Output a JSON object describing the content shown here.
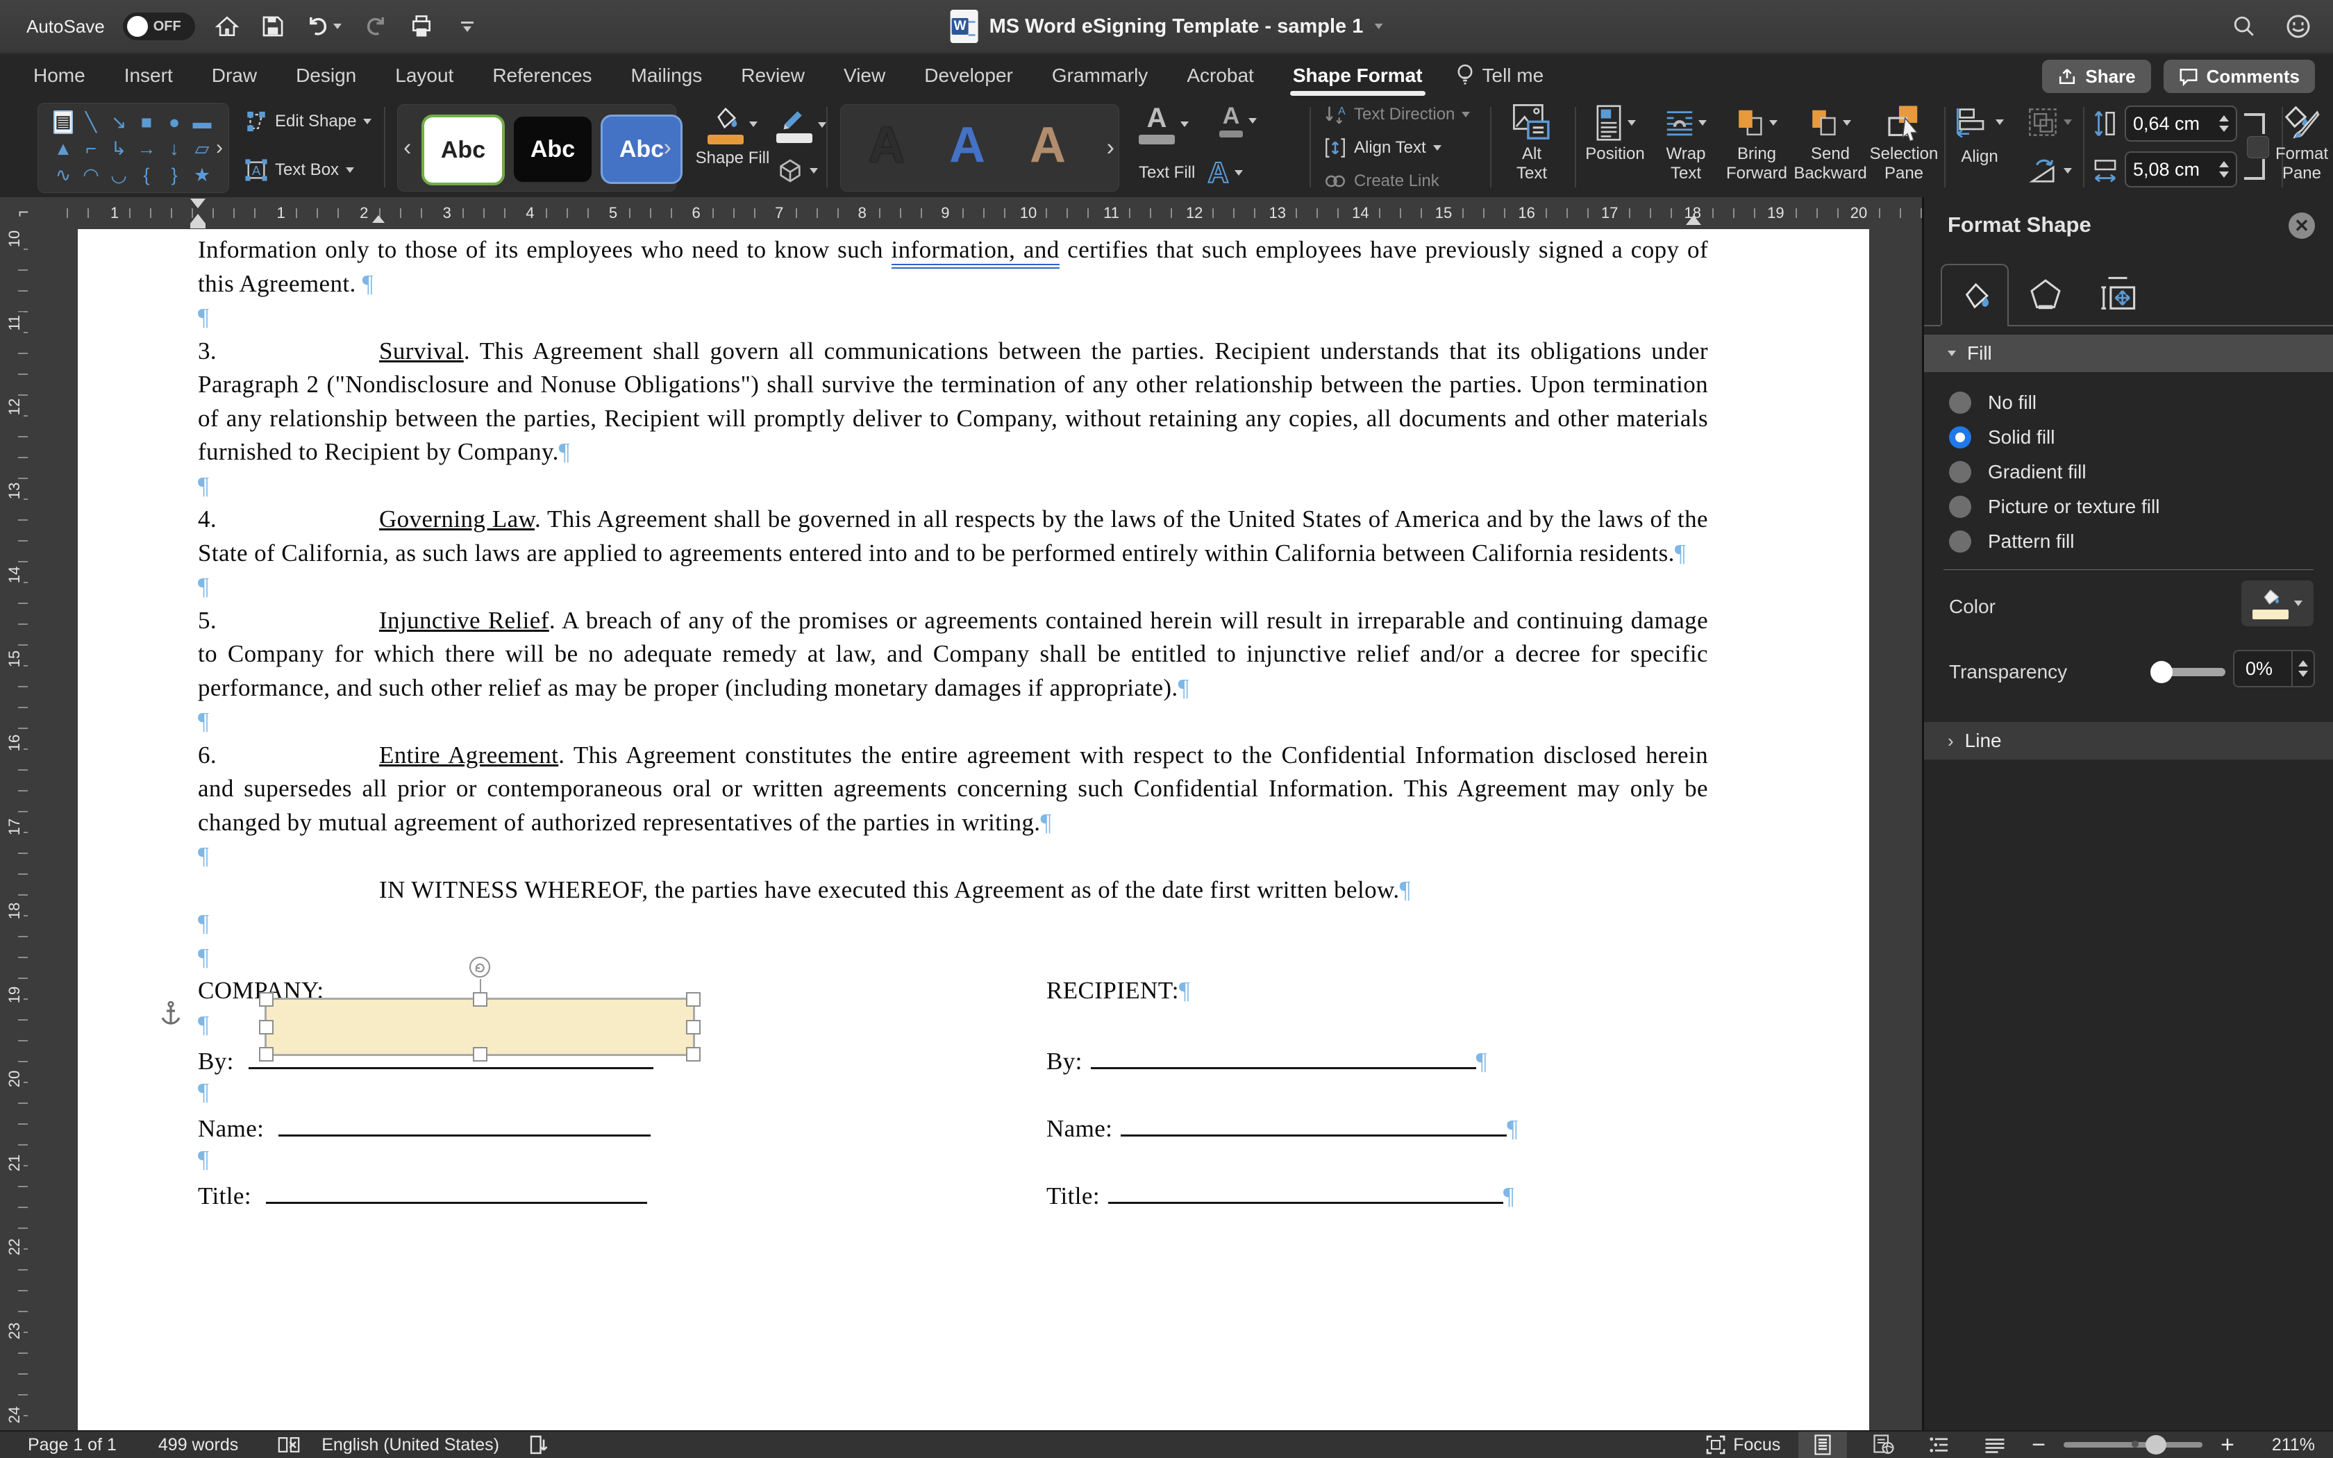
{
  "titlebar": {
    "autosave_label": "AutoSave",
    "autosave_state": "OFF",
    "title": "MS Word eSigning Template - sample 1"
  },
  "tabs": {
    "items": [
      "Home",
      "Insert",
      "Draw",
      "Design",
      "Layout",
      "References",
      "Mailings",
      "Review",
      "View",
      "Developer",
      "Grammarly",
      "Acrobat",
      "Shape Format"
    ],
    "active": "Shape Format",
    "tell_me": "Tell me",
    "share": "Share",
    "comments": "Comments"
  },
  "ribbon": {
    "shape_gallery_glyphs": [
      "▤",
      "╲",
      "↘",
      "■",
      "●",
      "▬",
      "▲",
      "⌐",
      "↳",
      "→",
      "↓",
      "▱",
      "∿",
      "◠",
      "◡",
      "{",
      "}",
      "★"
    ],
    "edit_shape": "Edit Shape",
    "text_box": "Text Box",
    "style_abc": "Abc",
    "shape_fill": "Shape Fill",
    "wordart_letter": "A",
    "text_fill": "Text Fill",
    "text_direction": "Text Direction",
    "align_text": "Align Text",
    "create_link": "Create Link",
    "alt_text_line1": "Alt",
    "alt_text_line2": "Text",
    "position": "Position",
    "wrap_text_line1": "Wrap",
    "wrap_text_line2": "Text",
    "bring_forward_line1": "Bring",
    "bring_forward_line2": "Forward",
    "send_backward_line1": "Send",
    "send_backward_line2": "Backward",
    "selection_pane_line1": "Selection",
    "selection_pane_line2": "Pane",
    "align": "Align",
    "height_value": "0,64 cm",
    "width_value": "5,08 cm",
    "format_pane_line1": "Format",
    "format_pane_line2": "Pane"
  },
  "ruler": {
    "h_margin_number": "1",
    "h_numbers": [
      "1",
      "2",
      "3",
      "4",
      "5",
      "6",
      "7",
      "8",
      "9",
      "10",
      "11",
      "12",
      "13",
      "14",
      "15",
      "16",
      "17",
      "18",
      "19",
      "20"
    ],
    "v_numbers": [
      "10",
      "11",
      "12",
      "13",
      "14",
      "15",
      "16",
      "17",
      "18",
      "19",
      "20",
      "21",
      "22",
      "23",
      "24"
    ]
  },
  "document": {
    "pilcrow": "¶",
    "intro": {
      "pre": "Information only to those of its employees who need to know such ",
      "flagged": "information, and",
      "post": " certifies that such employees have previously signed a copy of this Agreement. "
    },
    "paragraphs": [
      {
        "num": "3.",
        "heading": "Survival",
        "body": ".  This Agreement shall govern all communications between the parties.  Recipient understands that its obligations under Paragraph 2 (\"Nondisclosure and Nonuse Obligations\") shall survive the termination of any other relationship between the parties.  Upon termination of any relationship between the parties, Recipient will promptly deliver to Company, without retaining any copies, all documents and other materials furnished to Recipient by Company."
      },
      {
        "num": "4.",
        "heading": "Governing Law",
        "body": ".  This Agreement shall be governed in all respects by the laws of the United States of America and by the laws of the State of California, as such laws are applied to agreements entered into and to be performed entirely within California between California residents."
      },
      {
        "num": "5.",
        "heading": "Injunctive Relief",
        "body": ".  A breach of any of the promises or agreements contained herein will result in irreparable and continuing damage to Company for which there will be no adequate remedy at law, and Company shall be entitled to injunctive relief and/or a decree for specific performance, and such other relief as may be proper (including monetary damages if appropriate)."
      },
      {
        "num": "6.",
        "heading": "Entire Agreement",
        "body": ".  This Agreement constitutes the entire agreement with respect to the Confidential Information disclosed herein and supersedes all prior or contemporaneous oral or written agreements concerning such Confidential Information.  This Agreement may only be changed by mutual agreement of authorized representatives of the parties in writing."
      }
    ],
    "witness": "IN WITNESS WHEREOF, the parties have executed this Agreement as of the date first written below.",
    "signature": {
      "company_label": "COMPANY:",
      "recipient_label": "RECIPIENT:",
      "by_label": "By:",
      "name_label": "Name:",
      "title_label": "Title:"
    }
  },
  "format_pane": {
    "title": "Format Shape",
    "fill_section": "Fill",
    "options": [
      "No fill",
      "Solid fill",
      "Gradient fill",
      "Picture or texture fill",
      "Pattern fill"
    ],
    "selected_option": "Solid fill",
    "color_label": "Color",
    "transparency_label": "Transparency",
    "transparency_value": "0%",
    "line_section": "Line",
    "fill_color": "#f8ecc6"
  },
  "statusbar": {
    "page": "Page 1 of 1",
    "words": "499 words",
    "language": "English (United States)",
    "focus": "Focus",
    "zoom": "211%"
  },
  "colors": {
    "accent_orange": "#e8993c",
    "accent_blue": "#5b9bd5",
    "radio_blue": "#1f79e8",
    "shape_fill": "#f8ecc6",
    "pilcrow_blue": "#7fb7e6"
  }
}
